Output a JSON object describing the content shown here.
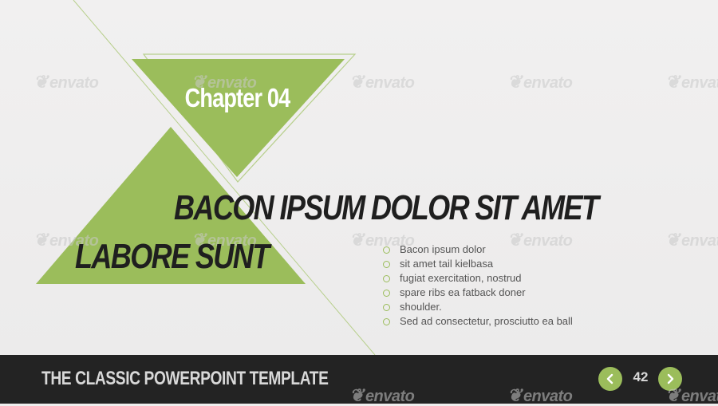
{
  "slide": {
    "chapter_label": "Chapter 04",
    "headline_line1": "BACON IPSUM DOLOR SIT AMET",
    "headline_line2": "LABORE SUNT",
    "bullets": [
      "Bacon ipsum dolor",
      "sit amet tail kielbasa",
      "fugiat exercitation, nostrud",
      "spare ribs ea fatback doner",
      "shoulder.",
      "Sed ad consectetur, prosciutto ea ball"
    ]
  },
  "footer": {
    "title": "THE CLASSIC POWERPOINT TEMPLATE",
    "page_number": "42",
    "prev_icon": "chevron-left-icon",
    "next_icon": "chevron-right-icon"
  },
  "watermark": {
    "text": "envato"
  },
  "colors": {
    "accent_green": "#9bbd5b",
    "background": "#efeeee",
    "footer_bg": "#232323",
    "headline": "#1f1f1f",
    "footer_text": "#d8d8d8"
  }
}
